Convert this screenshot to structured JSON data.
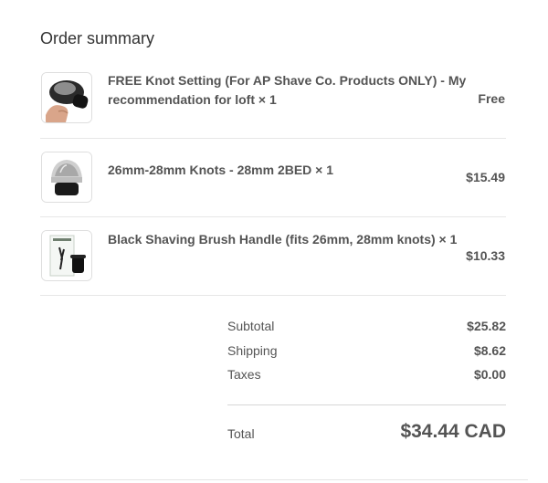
{
  "summary": {
    "title": "Order summary",
    "items": [
      {
        "name": "FREE Knot Setting (For AP Shave Co. Products ONLY) - My recommendation for loft × 1",
        "price": "Free",
        "image": "knot-setting-photo"
      },
      {
        "name": "26mm-28mm Knots - 28mm 2BED × 1",
        "price": "$15.49",
        "image": "knot-photo"
      },
      {
        "name": "Black Shaving Brush Handle (fits 26mm, 28mm knots) × 1",
        "price": "$10.33",
        "image": "brush-handle-photo"
      }
    ],
    "subtotal_label": "Subtotal",
    "subtotal": "$25.82",
    "shipping_label": "Shipping",
    "shipping": "$8.62",
    "taxes_label": "Taxes",
    "taxes": "$0.00",
    "total_label": "Total",
    "total": "$34.44 CAD"
  }
}
